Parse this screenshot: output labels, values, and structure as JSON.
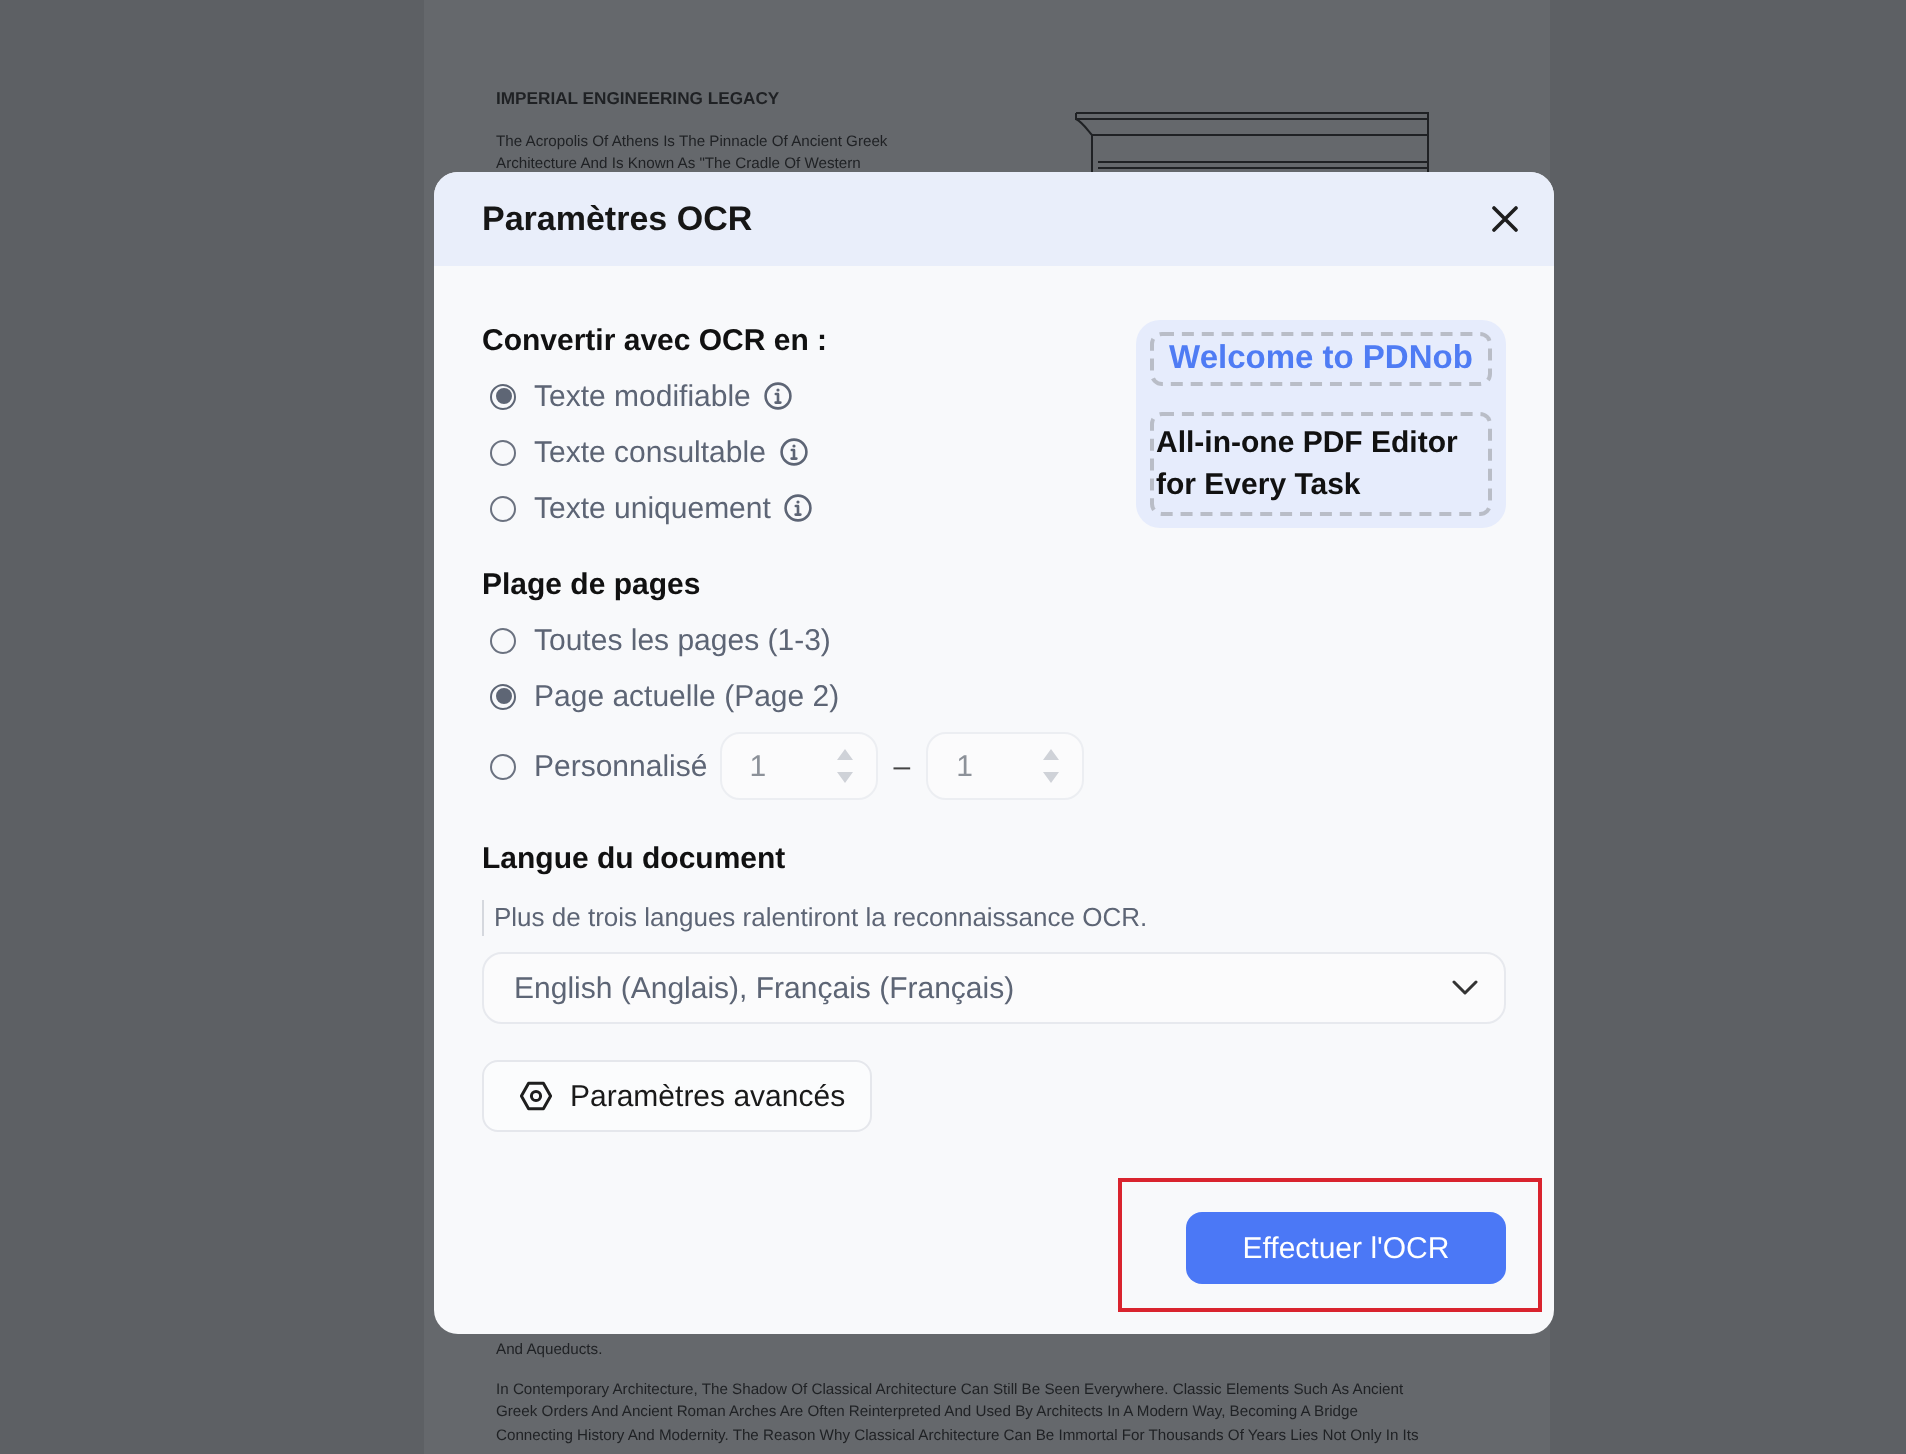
{
  "background_document": {
    "heading": "IMPERIAL ENGINEERING LEGACY",
    "intro_lines": [
      "The Acropolis Of Athens Is The Pinnacle Of Ancient Greek",
      "Architecture And Is Known As \"The Cradle Of Western"
    ],
    "tail_line": "And Aqueducts.",
    "paragraph_lines": [
      "In Contemporary Architecture, The Shadow Of Classical Architecture Can Still Be Seen Everywhere. Classic Elements Such As Ancient",
      "Greek Orders And Ancient Roman Arches Are Often Reinterpreted And Used By Architects In A Modern Way, Becoming A Bridge",
      "Connecting History And Modernity. The Reason Why Classical Architecture Can Be Immortal For Thousands Of Years Lies Not Only In Its"
    ]
  },
  "dialog": {
    "title": "Paramètres OCR",
    "output_section": {
      "heading": "Convertir avec OCR en :",
      "options": [
        {
          "label": "Texte modifiable",
          "selected": true,
          "info": true
        },
        {
          "label": "Texte consultable",
          "selected": false,
          "info": true
        },
        {
          "label": "Texte uniquement",
          "selected": false,
          "info": true
        }
      ]
    },
    "promo": {
      "title": "Welcome to PDNob",
      "tagline_lines": [
        "All-in-one PDF Editor",
        "for Every Task"
      ]
    },
    "page_range": {
      "heading": "Plage de pages",
      "options": [
        {
          "kind": "plain",
          "label": "Toutes les pages (1-3)",
          "selected": false
        },
        {
          "kind": "plain",
          "label": "Page actuelle (Page 2)",
          "selected": true
        },
        {
          "kind": "custom",
          "label": "Personnalisé",
          "selected": false,
          "from": {
            "value": "1",
            "disabled": true
          },
          "separator": "–",
          "to": {
            "value": "1",
            "disabled": true
          }
        }
      ]
    },
    "language": {
      "heading": "Langue du document",
      "hint": "Plus de trois langues ralentiront la reconnaissance OCR.",
      "dropdown": {
        "value": "English (Anglais), Français (Français)"
      }
    },
    "advanced_button": {
      "label": "Paramètres avancés"
    },
    "run_button": {
      "label": "Effectuer l'OCR",
      "highlighted": true
    }
  }
}
